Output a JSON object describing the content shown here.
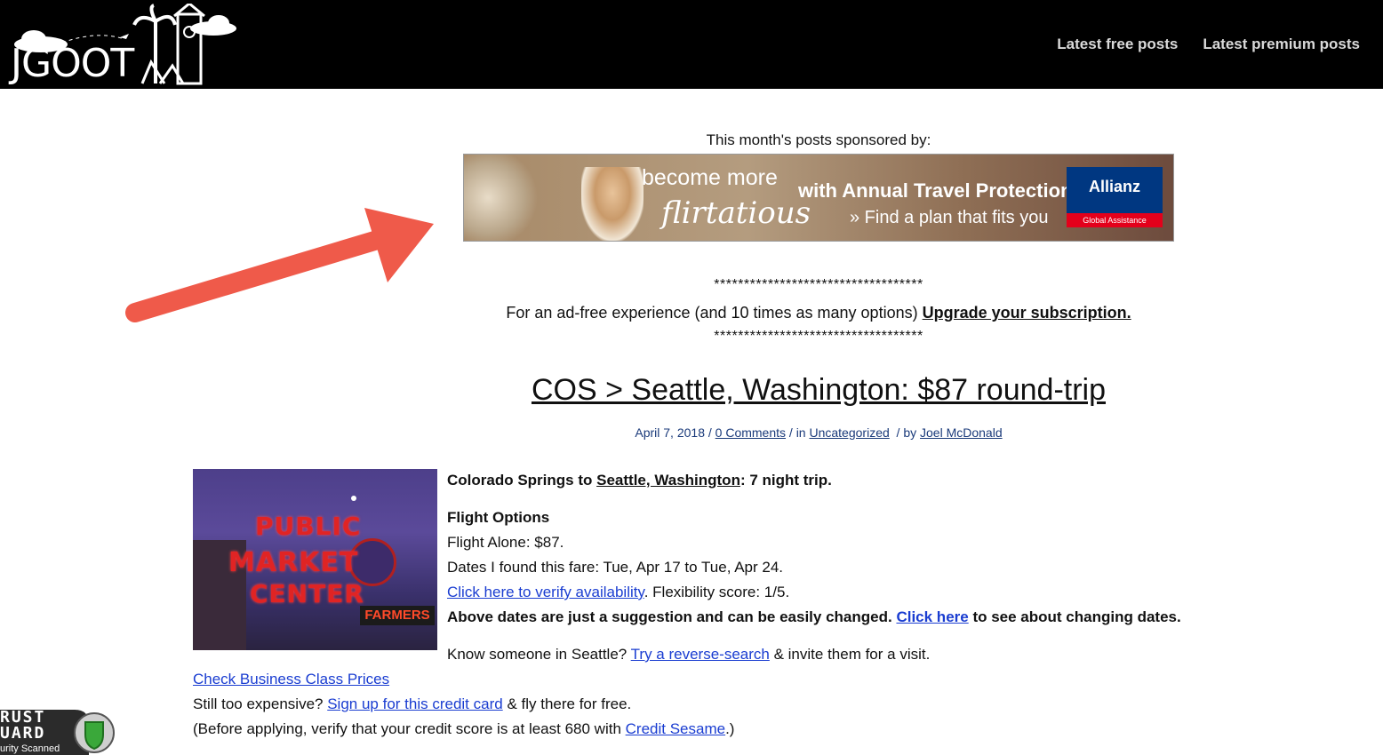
{
  "header": {
    "logo_text": "JGOOT",
    "nav": [
      "Latest free posts",
      "Latest premium posts"
    ]
  },
  "sponsor": {
    "label": "This month's posts sponsored by:",
    "banner": {
      "line1": "become more",
      "line2": "flirtatious",
      "line3": "with Annual Travel Protection",
      "line4": "» Find a plan that fits you",
      "brand": "Allianz",
      "brand_sub": "Global Assistance"
    }
  },
  "adfree": {
    "stars": "***********************************",
    "text": "For an ad-free experience (and 10 times as many options)",
    "link": "Upgrade your subscription."
  },
  "post": {
    "title": "COS > Seattle, Washington: $87 round-trip",
    "date": "April 7, 2018",
    "comments": "0 Comments",
    "in_label": "in",
    "category": "Uncategorized",
    "by_label": "by",
    "author": "Joel McDonald",
    "image_sign": [
      "PUBLIC",
      "MARKET",
      "CENTER",
      "FARMERS"
    ],
    "intro_pre": "Colorado Springs to",
    "intro_link": "Seattle, Washington",
    "intro_post": ": 7 night trip.",
    "flight_heading": "Flight Options",
    "flight_alone": "Flight Alone: $87.",
    "dates": "Dates I found this fare: Tue, Apr 17 to Tue, Apr 24.",
    "verify_link": "Click here to verify availability",
    "flex": ". Flexibility score: 1/5.",
    "suggestion": "Above dates are just a suggestion and can be easily changed.",
    "click_here": "Click here",
    "change_dates": "to see about changing dates.",
    "know_pre": "Know someone in Seattle?",
    "reverse_link": "Try a reverse-search",
    "know_post": "& invite them for a visit.",
    "business_link": "Check Business Class Prices",
    "expensive_pre": "Still too expensive?",
    "credit_link": "Sign up for this credit card",
    "expensive_post": "& fly there for free.",
    "before_pre": "(Before applying, verify that your credit score is at least 680 with",
    "sesame_link": "Credit Sesame",
    "before_post": ".)"
  },
  "trust_badge": {
    "line1": "RUST",
    "line2": "UARD",
    "line3": "urity Scanned"
  },
  "colors": {
    "arrow": "#ef5a4a",
    "link": "#1a3dd1",
    "meta": "#1a3a7a"
  }
}
